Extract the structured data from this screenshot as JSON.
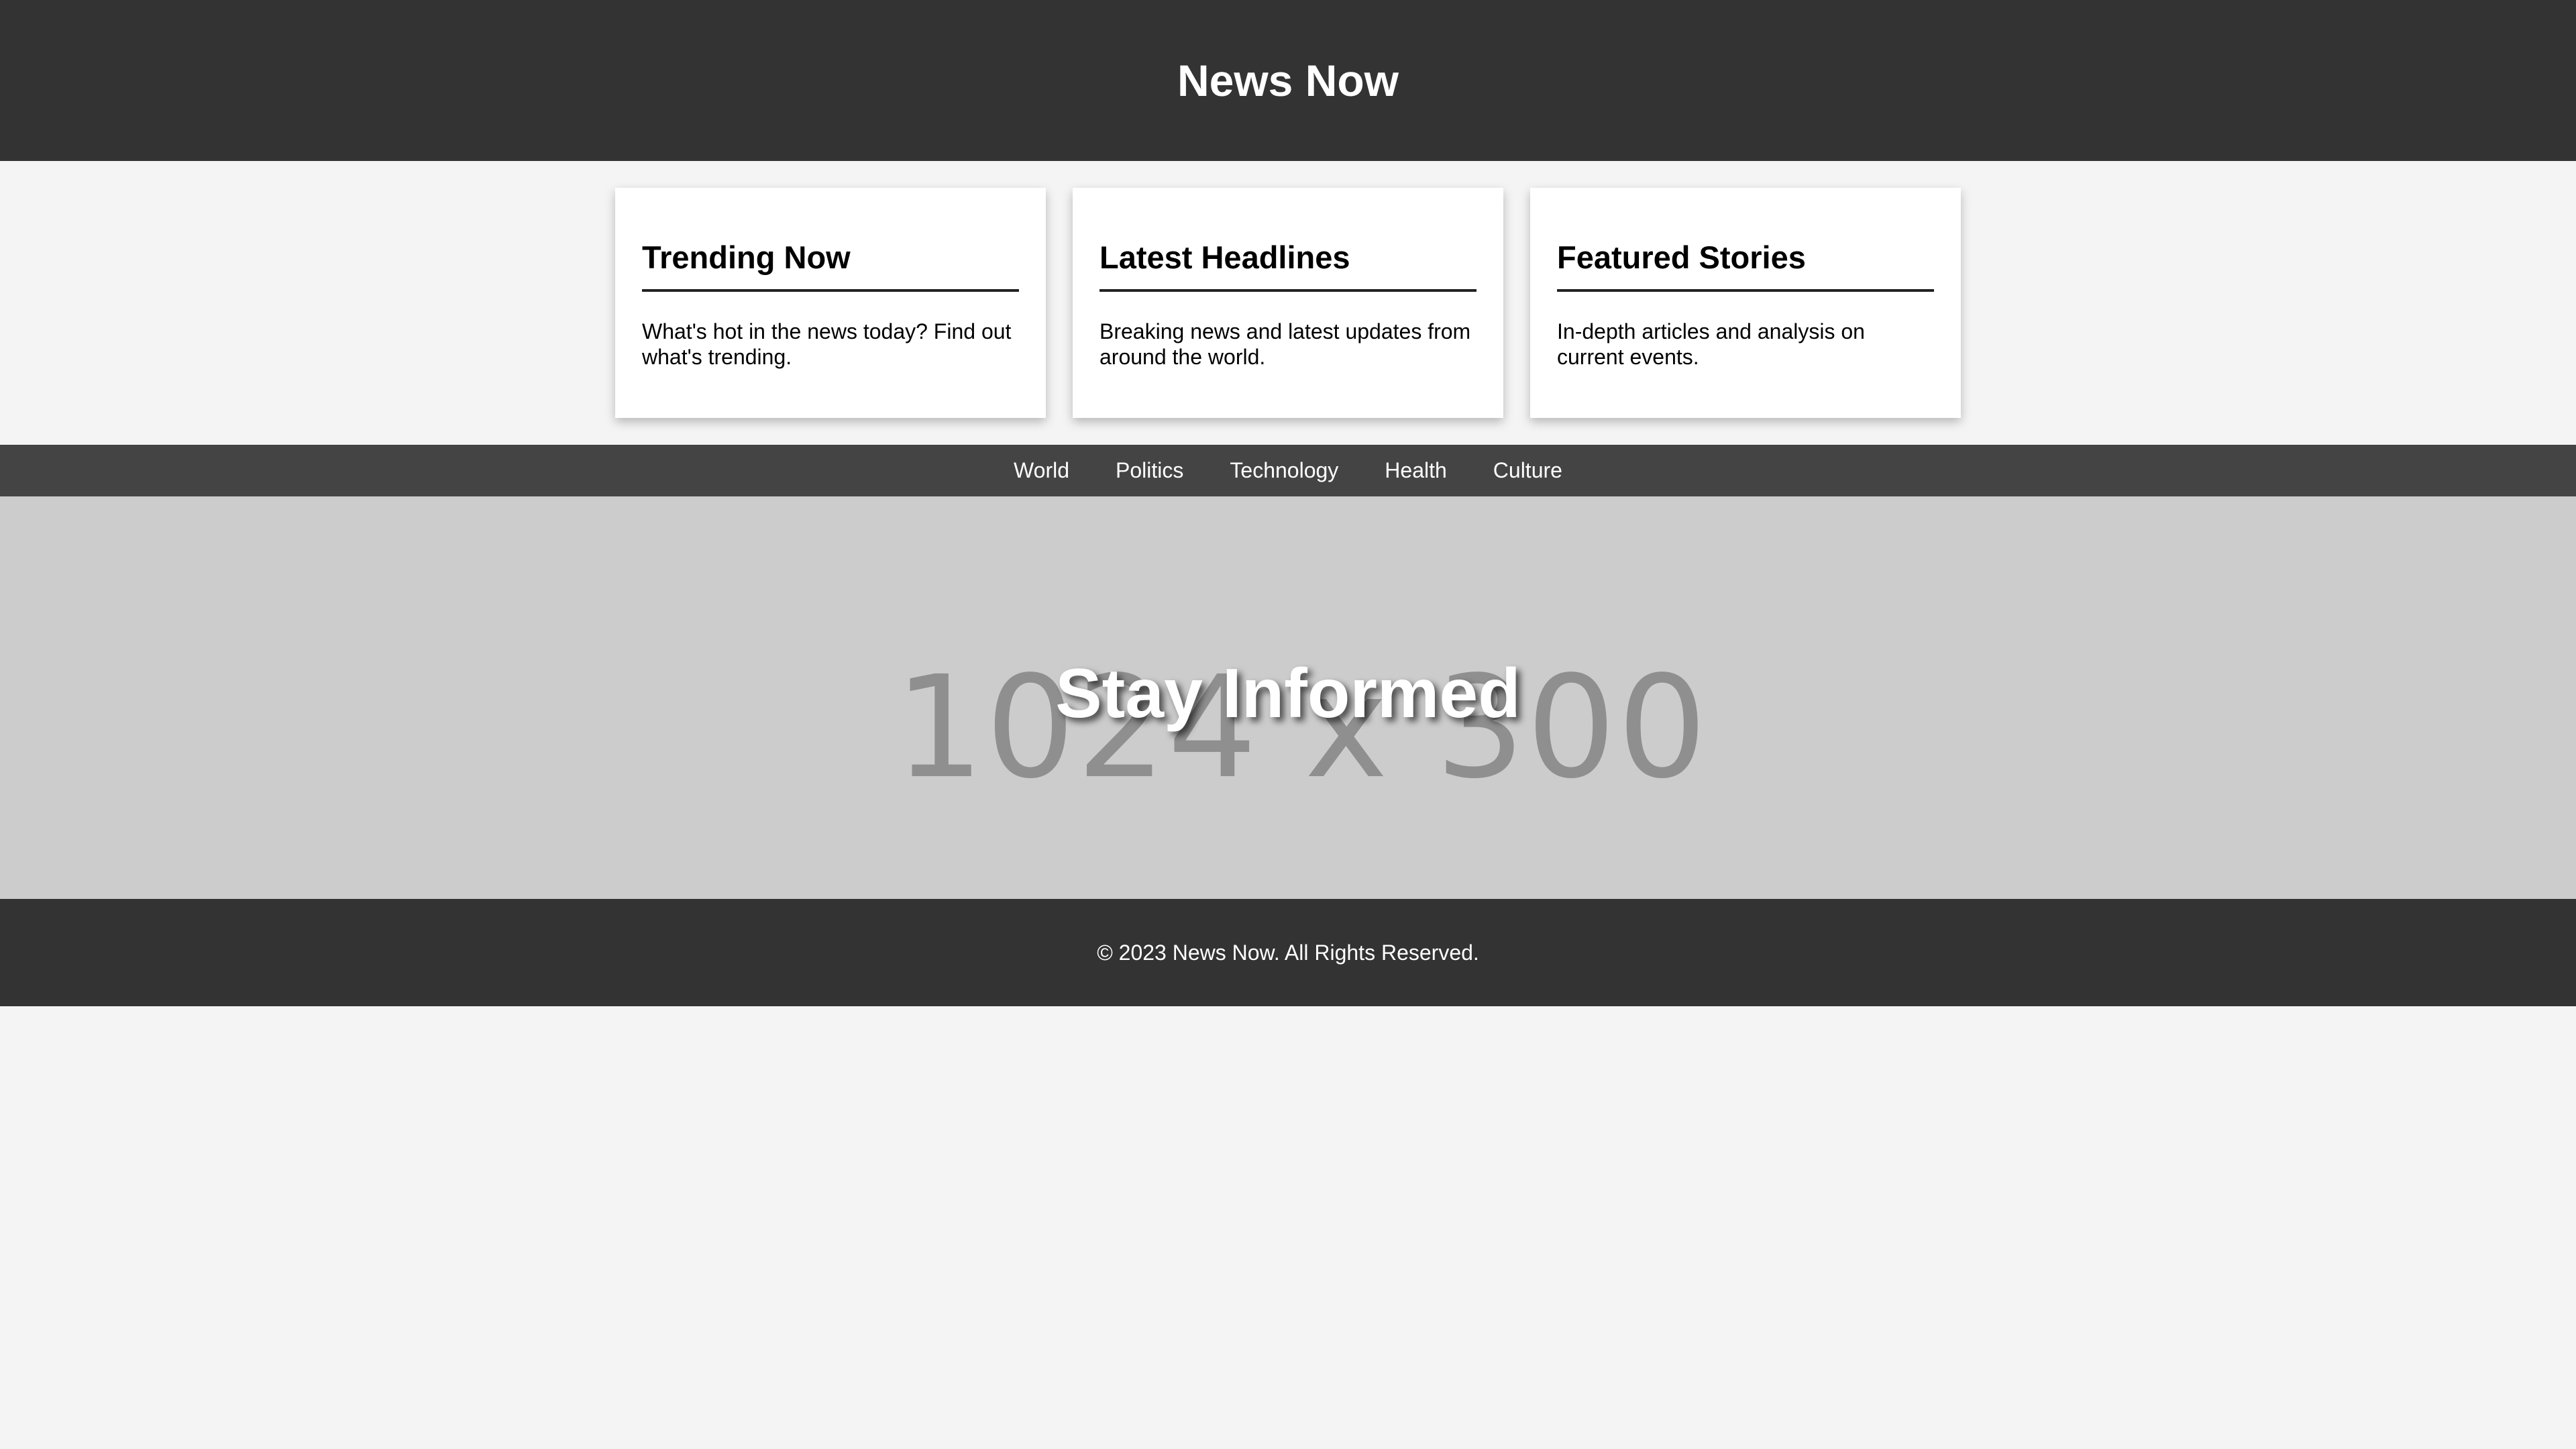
{
  "header": {
    "title": "News Now"
  },
  "cards": [
    {
      "title": "Trending Now",
      "text": "What's hot in the news today? Find out what's trending."
    },
    {
      "title": "Latest Headlines",
      "text": "Breaking news and latest updates from around the world."
    },
    {
      "title": "Featured Stories",
      "text": "In-depth articles and analysis on current events."
    }
  ],
  "nav": {
    "items": [
      {
        "label": "World"
      },
      {
        "label": "Politics"
      },
      {
        "label": "Technology"
      },
      {
        "label": "Health"
      },
      {
        "label": "Culture"
      }
    ]
  },
  "hero": {
    "image_placeholder": "1024 x 300",
    "title": "Stay Informed"
  },
  "footer": {
    "text": "© 2023 News Now. All Rights Reserved."
  },
  "colors": {
    "header_bg": "#333333",
    "nav_bg": "#444444",
    "hero_bg": "#cccccc",
    "page_bg": "#f4f4f4"
  }
}
